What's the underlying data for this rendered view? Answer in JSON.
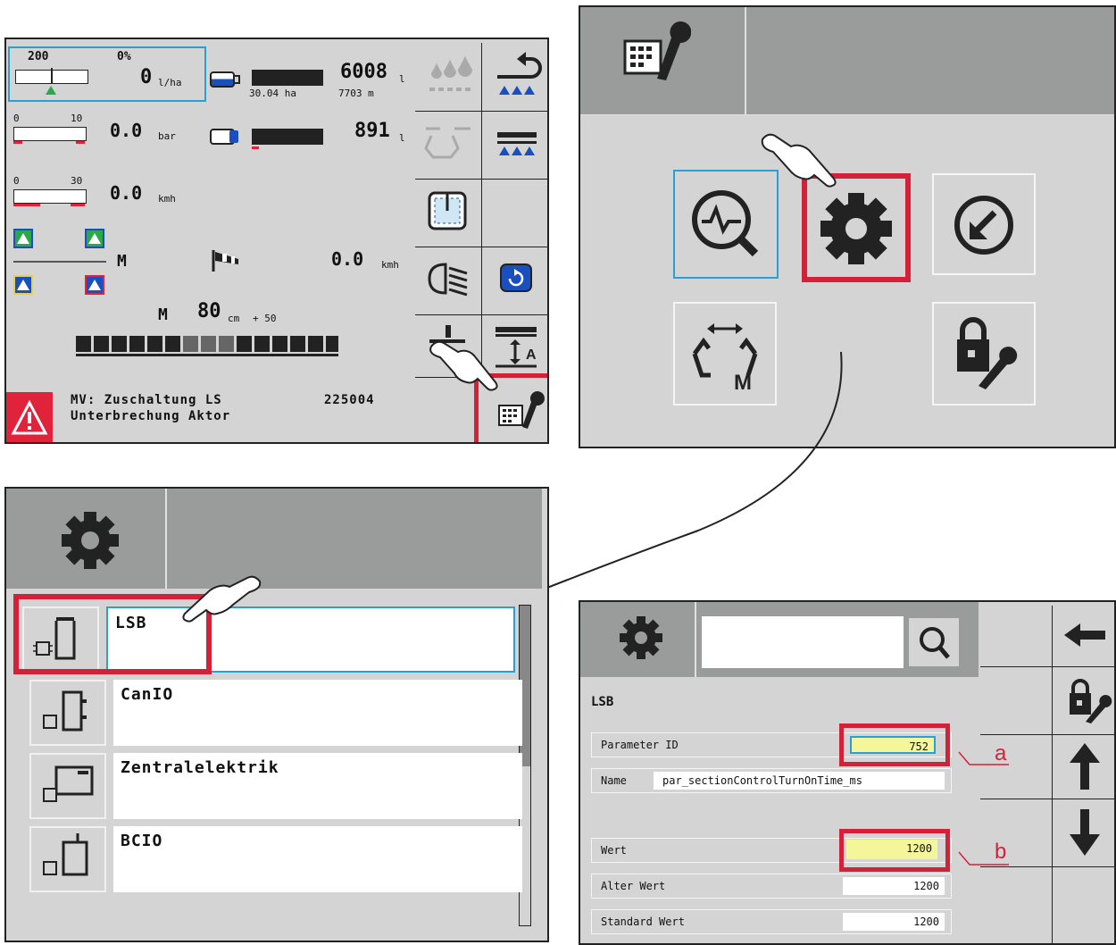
{
  "panel_main": {
    "rate_target": "200",
    "rate_percent": "0%",
    "rate_value": "0",
    "rate_unit": "l/ha",
    "pressure_min": "0",
    "pressure_max": "10",
    "pressure_value": "0.0",
    "pressure_unit": "bar",
    "speed_min": "0",
    "speed_max": "30",
    "speed_value": "0.0",
    "speed_unit": "kmh",
    "tank_main_value": "6008",
    "tank_main_unit": "l",
    "area_value": "30.04 ha",
    "distance_value": "7703 m",
    "tank_second_value": "891",
    "tank_second_unit": "l",
    "mode_label": "M",
    "wind_speed_value": "0.0",
    "wind_speed_unit": "kmh",
    "height_mode": "M",
    "height_value": "80",
    "height_unit": "cm",
    "height_offset": "+ 50",
    "alarm_line1": "MV: Zuschaltung LS",
    "alarm_line2": "Unterbrechung Aktor",
    "alarm_code": "225004"
  },
  "panel_service": {
    "icons": [
      "diagnostics-icon",
      "settings-gear-icon",
      "download-icon",
      "boom-adjust-icon",
      "lock-wrench-icon"
    ],
    "boom_mode_label": "M"
  },
  "panel_devices": {
    "items": [
      {
        "label": "LSB"
      },
      {
        "label": "CanIO"
      },
      {
        "label": "Zentralelektrik"
      },
      {
        "label": "BCIO"
      }
    ]
  },
  "panel_params": {
    "section_title": "LSB",
    "param_id_label": "Parameter ID",
    "param_id_value": "752",
    "name_label": "Name",
    "name_value": "par_sectionControlTurnOnTime_ms",
    "value_label": "Wert",
    "value_value": "1200",
    "old_value_label": "Alter Wert",
    "old_value_value": "1200",
    "default_value_label": "Standard Wert",
    "default_value_value": "1200",
    "callout_a": "a",
    "callout_b": "b"
  },
  "colors": {
    "panel_bg": "#d4d4d4",
    "header_bg": "#9a9c9c",
    "highlight_red": "#d3213a",
    "focus_blue": "#2a9fd6",
    "input_yellow": "#f5f59a",
    "arrow_blue": "#1a4fc0",
    "alert_red": "#e0223a",
    "green_indicator": "#2aa84a"
  }
}
